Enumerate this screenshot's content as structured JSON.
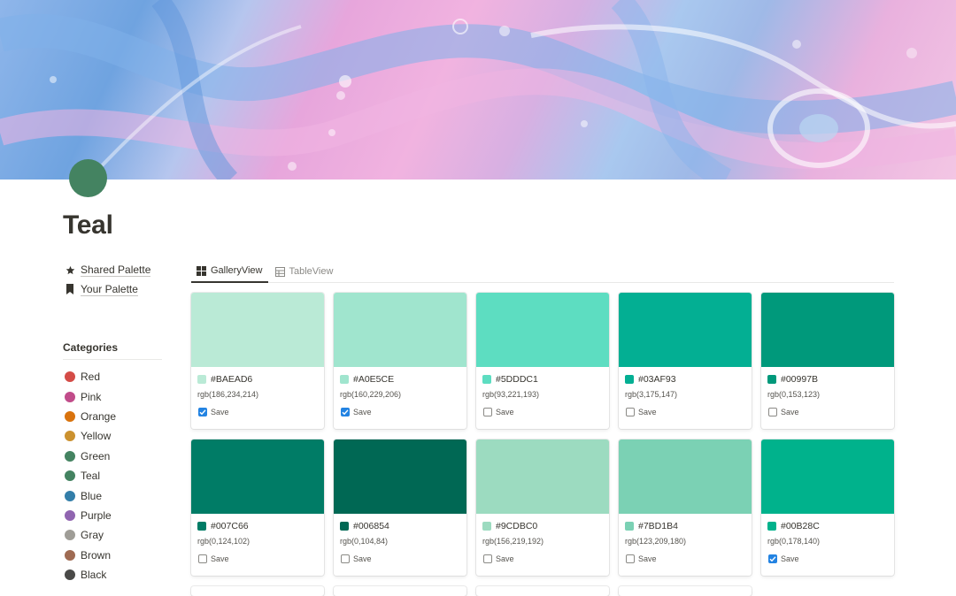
{
  "page": {
    "title": "Teal",
    "icon_color": "#448361"
  },
  "sidebar": {
    "links": [
      {
        "label": "Shared Palette",
        "icon": "star-icon"
      },
      {
        "label": "Your Palette",
        "icon": "bookmark-icon"
      }
    ],
    "categories_title": "Categories",
    "categories": [
      {
        "label": "Red",
        "color": "#d44c47"
      },
      {
        "label": "Pink",
        "color": "#c14c8a"
      },
      {
        "label": "Orange",
        "color": "#d9730d"
      },
      {
        "label": "Yellow",
        "color": "#cb912f"
      },
      {
        "label": "Green",
        "color": "#448361"
      },
      {
        "label": "Teal",
        "color": "#448361"
      },
      {
        "label": "Blue",
        "color": "#337ea9"
      },
      {
        "label": "Purple",
        "color": "#9065b0"
      },
      {
        "label": "Gray",
        "color": "#9f9d97"
      },
      {
        "label": "Brown",
        "color": "#9f6b53"
      },
      {
        "label": "Black",
        "color": "#4a4a48"
      }
    ]
  },
  "tabs": [
    {
      "label": "GalleryView",
      "icon": "gallery-grid-icon",
      "active": true
    },
    {
      "label": "TableView",
      "icon": "table-icon",
      "active": false
    }
  ],
  "save_label": "Save",
  "cards": [
    {
      "hex": "#BAEAD6",
      "rgb": "rgb(186,234,214)",
      "color": "#BAEAD6",
      "saved": true
    },
    {
      "hex": "#A0E5CE",
      "rgb": "rgb(160,229,206)",
      "color": "#A0E5CE",
      "saved": true
    },
    {
      "hex": "#5DDDC1",
      "rgb": "rgb(93,221,193)",
      "color": "#5DDDC1",
      "saved": false
    },
    {
      "hex": "#03AF93",
      "rgb": "rgb(3,175,147)",
      "color": "#03AF93",
      "saved": false
    },
    {
      "hex": "#00997B",
      "rgb": "rgb(0,153,123)",
      "color": "#00997B",
      "saved": false
    },
    {
      "hex": "#007C66",
      "rgb": "rgb(0,124,102)",
      "color": "#007C66",
      "saved": false
    },
    {
      "hex": "#006854",
      "rgb": "rgb(0,104,84)",
      "color": "#006854",
      "saved": false
    },
    {
      "hex": "#9CDBC0",
      "rgb": "rgb(156,219,192)",
      "color": "#9CDBC0",
      "saved": false
    },
    {
      "hex": "#7BD1B4",
      "rgb": "rgb(123,209,180)",
      "color": "#7BD1B4",
      "saved": false
    },
    {
      "hex": "#00B28C",
      "rgb": "rgb(0,178,140)",
      "color": "#00B28C",
      "saved": true
    }
  ]
}
